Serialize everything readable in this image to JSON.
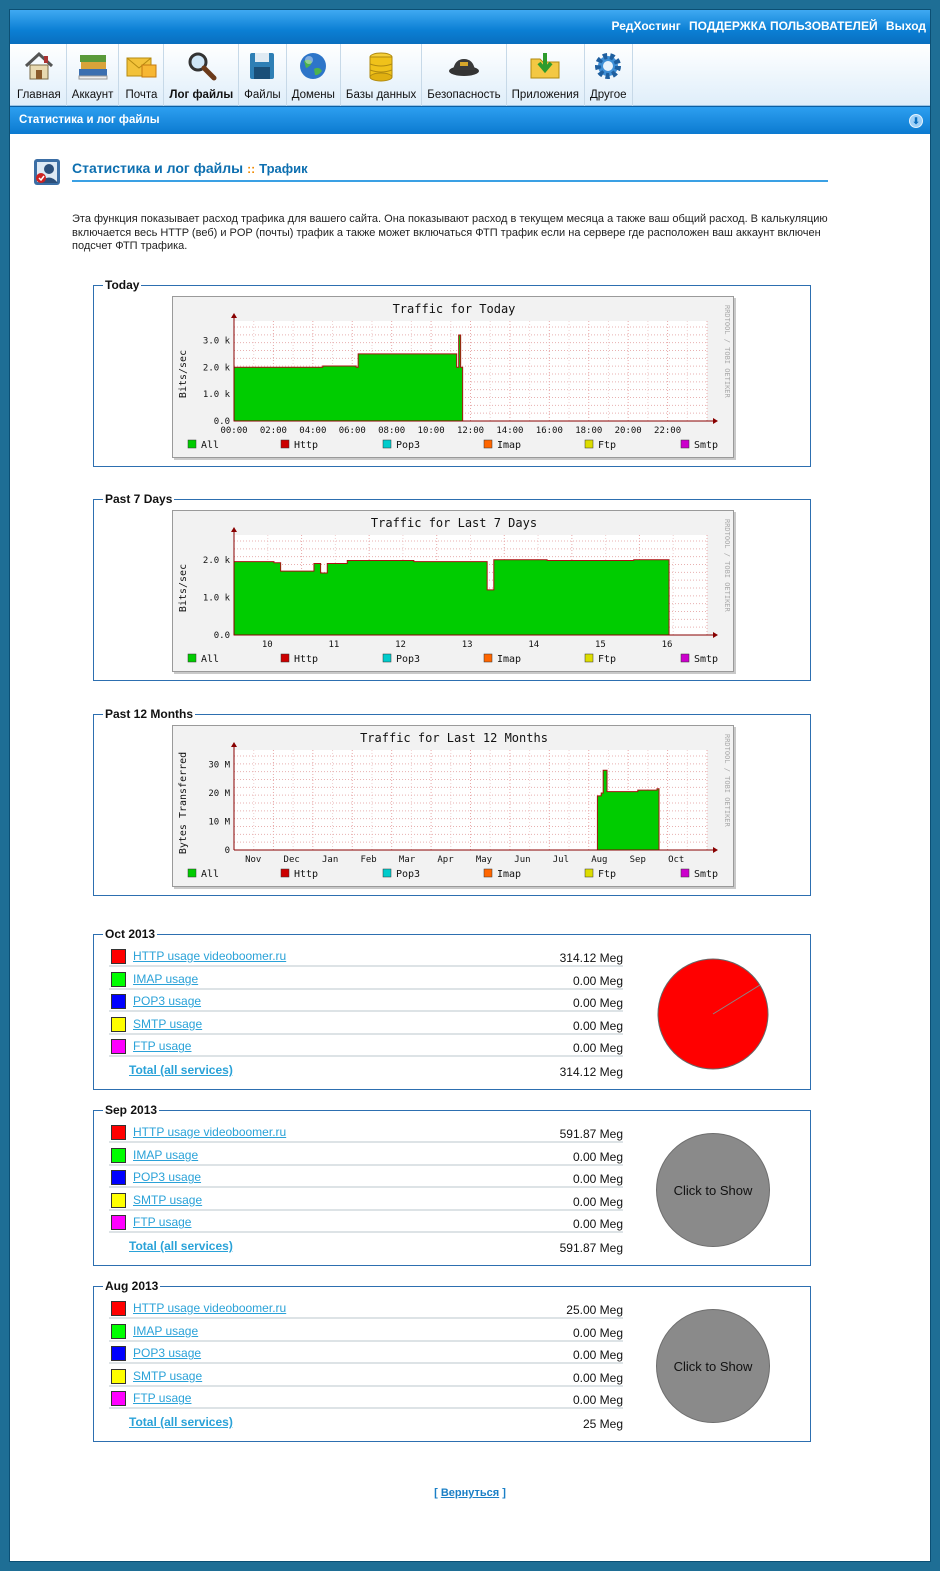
{
  "topbar": {
    "links": [
      "РедХостинг",
      "ПОДДЕРЖКА ПОЛЬЗОВАТЕЛЕЙ",
      "Выход"
    ]
  },
  "nav": {
    "items": [
      {
        "label": "Главная",
        "icon": "home-icon"
      },
      {
        "label": "Аккаунт",
        "icon": "books-icon"
      },
      {
        "label": "Почта",
        "icon": "mail-icon"
      },
      {
        "label": "Лог файлы",
        "icon": "magnifier-icon",
        "active": true
      },
      {
        "label": "Файлы",
        "icon": "floppy-icon"
      },
      {
        "label": "Домены",
        "icon": "globe-icon"
      },
      {
        "label": "Базы данных",
        "icon": "database-icon"
      },
      {
        "label": "Безопасность",
        "icon": "security-cap-icon"
      },
      {
        "label": "Приложения",
        "icon": "folder-download-icon"
      },
      {
        "label": "Другое",
        "icon": "gear-icon"
      }
    ]
  },
  "section": {
    "title": "Статистика и лог файлы"
  },
  "heading": {
    "title": "Статистика и лог файлы",
    "separator": "::",
    "subtitle": "Трафик"
  },
  "intro": "Эта функция показывает расход трафика для вашего сайта. Она показывают расход в текущем месяца а также ваш общий расход. В калькуляцию включается весь HTTP (веб) и POP (почты) трафик а также может включаться ФТП трафик если на сервере где расположен ваш аккаунт включен подсчет ФТП трафика.",
  "legend": [
    {
      "name": "All",
      "color": "#00cc00"
    },
    {
      "name": "Http",
      "color": "#cc0000"
    },
    {
      "name": "Pop3",
      "color": "#00cccc"
    },
    {
      "name": "Imap",
      "color": "#ff6600"
    },
    {
      "name": "Ftp",
      "color": "#dddd00"
    },
    {
      "name": "Smtp",
      "color": "#cc00cc"
    }
  ],
  "watermark": "RRDTOOL / TOBI OETIKER",
  "charts": [
    {
      "legend": "Today",
      "chart_data": {
        "type": "area",
        "title": "Traffic for Today",
        "ylabel": "Bits/sec",
        "yticks": [
          "0.0",
          "1.0 k",
          "2.0 k",
          "3.0 k"
        ],
        "ylim": [
          0,
          3500
        ],
        "xticks": [
          "00:00",
          "02:00",
          "04:00",
          "06:00",
          "08:00",
          "10:00",
          "12:00",
          "14:00",
          "16:00",
          "18:00",
          "20:00",
          "22:00"
        ],
        "xlim": [
          0,
          24
        ],
        "series": [
          {
            "name": "All",
            "x": [
              0,
              4.4,
              4.5,
              6.2,
              6.3,
              11.3,
              11.4,
              11.5
            ],
            "values": [
              2000,
              2000,
              2050,
              2000,
              2500,
              2000,
              3200,
              2000
            ]
          }
        ]
      }
    },
    {
      "legend": "Past 7 Days",
      "chart_data": {
        "type": "area",
        "title": "Traffic for Last 7 Days",
        "ylabel": "Bits/sec",
        "yticks": [
          "0.0",
          "1.0 k",
          "2.0 k"
        ],
        "ylim": [
          0,
          2500
        ],
        "xticks": [
          "10",
          "11",
          "12",
          "13",
          "14",
          "15",
          "16"
        ],
        "xlim": [
          9.5,
          16.6
        ],
        "series": [
          {
            "name": "All",
            "x": [
              9.5,
              10.1,
              10.2,
              10.7,
              10.8,
              10.9,
              11.2,
              12.2,
              13.3,
              13.4,
              14.2,
              15.5,
              16.0
            ],
            "values": [
              1950,
              1920,
              1700,
              1900,
              1650,
              1900,
              1980,
              1950,
              1200,
              2000,
              1980,
              2000,
              2000
            ]
          }
        ]
      }
    },
    {
      "legend": "Past 12 Months",
      "chart_data": {
        "type": "area",
        "title": "Traffic for Last 12 Months",
        "ylabel": "Bytes Transferred",
        "yticks": [
          "0",
          "10 M",
          "20 M",
          "30 M"
        ],
        "ylim": [
          0,
          33
        ],
        "xticks": [
          "Nov",
          "Dec",
          "Jan",
          "Feb",
          "Mar",
          "Apr",
          "May",
          "Jun",
          "Jul",
          "Aug",
          "Sep",
          "Oct"
        ],
        "xlim": [
          0,
          12.3
        ],
        "series": [
          {
            "name": "All",
            "x": [
              9.45,
              9.55,
              9.6,
              9.7,
              10.5,
              11.0
            ],
            "values": [
              19,
              20,
              28,
              20.5,
              21,
              21.5
            ]
          }
        ]
      }
    }
  ],
  "usage": [
    {
      "legend": "Oct 2013",
      "rows": [
        {
          "label": "HTTP usage videoboomer.ru",
          "value": "314.12 Meg",
          "color": "#ff0000"
        },
        {
          "label": "IMAP usage",
          "value": "0.00 Meg",
          "color": "#00ff00"
        },
        {
          "label": "POP3 usage",
          "value": "0.00 Meg",
          "color": "#0000ff"
        },
        {
          "label": "SMTP usage",
          "value": "0.00 Meg",
          "color": "#ffff00"
        },
        {
          "label": "FTP usage",
          "value": "0.00 Meg",
          "color": "#ff00ff"
        }
      ],
      "total": {
        "label": "Total (all services)",
        "value": "314.12 Meg"
      },
      "pie": {
        "mode": "chart",
        "color": "#ff0000"
      }
    },
    {
      "legend": "Sep 2013",
      "rows": [
        {
          "label": "HTTP usage videoboomer.ru",
          "value": "591.87 Meg",
          "color": "#ff0000"
        },
        {
          "label": "IMAP usage",
          "value": "0.00 Meg",
          "color": "#00ff00"
        },
        {
          "label": "POP3 usage",
          "value": "0.00 Meg",
          "color": "#0000ff"
        },
        {
          "label": "SMTP usage",
          "value": "0.00 Meg",
          "color": "#ffff00"
        },
        {
          "label": "FTP usage",
          "value": "0.00 Meg",
          "color": "#ff00ff"
        }
      ],
      "total": {
        "label": "Total (all services)",
        "value": "591.87 Meg"
      },
      "pie": {
        "mode": "hidden",
        "text": "Click to Show"
      }
    },
    {
      "legend": "Aug 2013",
      "rows": [
        {
          "label": "HTTP usage videoboomer.ru",
          "value": "25.00 Meg",
          "color": "#ff0000"
        },
        {
          "label": "IMAP usage",
          "value": "0.00 Meg",
          "color": "#00ff00"
        },
        {
          "label": "POP3 usage",
          "value": "0.00 Meg",
          "color": "#0000ff"
        },
        {
          "label": "SMTP usage",
          "value": "0.00 Meg",
          "color": "#ffff00"
        },
        {
          "label": "FTP usage",
          "value": "0.00 Meg",
          "color": "#ff00ff"
        }
      ],
      "total": {
        "label": "Total (all services)",
        "value": "25 Meg"
      },
      "pie": {
        "mode": "hidden",
        "text": "Click to Show"
      }
    }
  ],
  "back": {
    "open": "[",
    "label": "Вернуться",
    "close": "]"
  }
}
